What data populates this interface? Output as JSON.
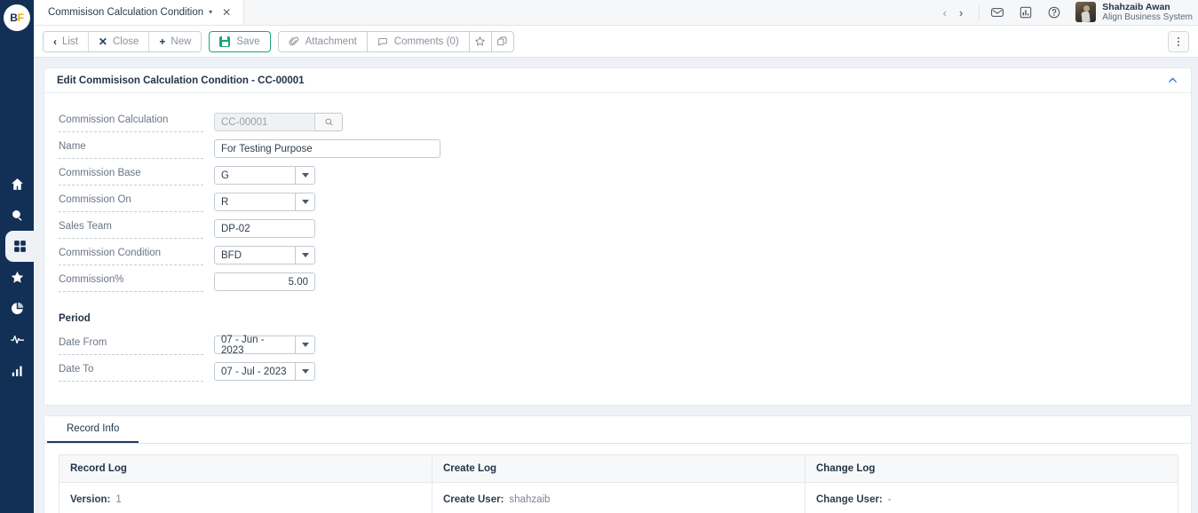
{
  "brand": {
    "logo_b": "B",
    "logo_f": "F",
    "accent_navy": "#123055",
    "accent_orange": "#f5a700",
    "accent_green": "#17a67a",
    "accent_blue": "#1565d8"
  },
  "sidebar": {
    "items": [
      {
        "name": "home-icon",
        "label": "Home",
        "active": false
      },
      {
        "name": "search-icon",
        "label": "Search",
        "active": false
      },
      {
        "name": "apps-grid-icon",
        "label": "Apps",
        "active": true
      },
      {
        "name": "star-icon",
        "label": "Favorites",
        "active": false
      },
      {
        "name": "pie-chart-icon",
        "label": "Reports",
        "active": false
      },
      {
        "name": "activity-pulse-icon",
        "label": "Activity",
        "active": false
      },
      {
        "name": "bar-chart-icon",
        "label": "Analytics",
        "active": false
      }
    ]
  },
  "tabbar": {
    "tab_label": "Commisison Calculation Condition",
    "tab_caret": "▾",
    "tab_close": "✕",
    "nav_prev": "‹",
    "nav_next": "›",
    "icons": [
      {
        "name": "mail-icon",
        "label": "Messages"
      },
      {
        "name": "chart-icon",
        "label": "Dashboard"
      },
      {
        "name": "help-icon",
        "label": "Help"
      }
    ],
    "user": {
      "name": "Shahzaib Awan",
      "org": "Align Business System"
    }
  },
  "toolbar": {
    "list_label": "List",
    "close_label": "Close",
    "new_label": "New",
    "save_label": "Save",
    "attachment_label": "Attachment",
    "comments_label": "Comments (0)",
    "favorite_icon": "☆",
    "copy_icon": "copy-icon",
    "kebab_label": "More actions"
  },
  "panel": {
    "title": "Edit Commisison Calculation Condition - CC-00001",
    "collapse_icon": "ⱏ"
  },
  "form": {
    "fields": [
      {
        "label": "Commission Calculation",
        "value": "CC-00001",
        "type": "lookup",
        "disabled": true
      },
      {
        "label": "Name",
        "value": "For Testing Purpose",
        "type": "text",
        "disabled": false
      },
      {
        "label": "Commission Base",
        "value": "G",
        "type": "select",
        "disabled": false
      },
      {
        "label": "Commission On",
        "value": "R",
        "type": "select",
        "disabled": false
      },
      {
        "label": "Sales Team",
        "value": "DP-02",
        "type": "text",
        "disabled": false
      },
      {
        "label": "Commission Condition",
        "value": "BFD",
        "type": "select",
        "disabled": false
      },
      {
        "label": "Commission%",
        "value": "5.00",
        "type": "number",
        "disabled": false
      }
    ],
    "period": {
      "title": "Period",
      "date_from_label": "Date From",
      "date_from_value": "07 - Jun - 2023",
      "date_to_label": "Date To",
      "date_to_value": "07 - Jul - 2023"
    }
  },
  "record_info": {
    "tab_label": "Record Info",
    "columns": [
      "Record Log",
      "Create Log",
      "Change Log"
    ],
    "rows": [
      {
        "key": "Version:",
        "value": "1"
      },
      {
        "key": "Create User:",
        "value": "shahzaib"
      },
      {
        "key": "Change User:",
        "value": "-"
      }
    ]
  }
}
